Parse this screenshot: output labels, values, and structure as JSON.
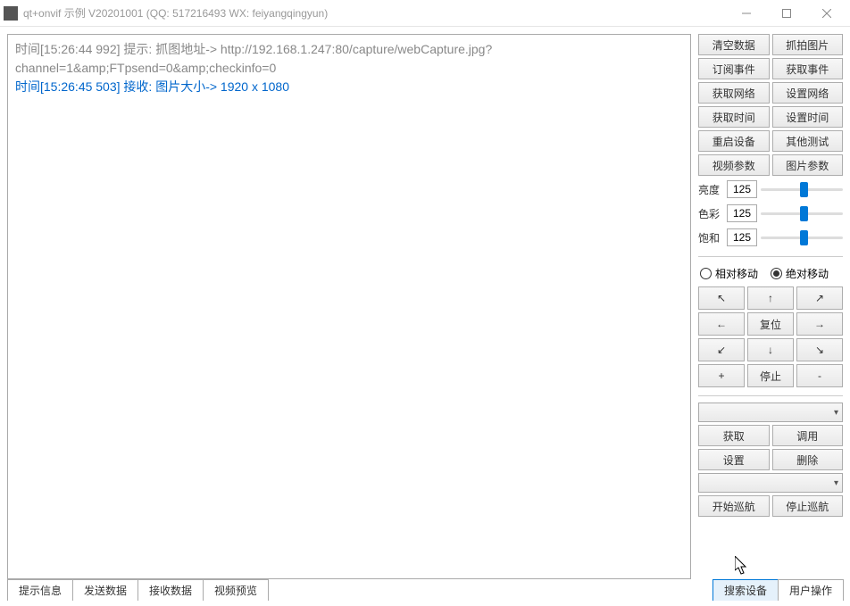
{
  "window": {
    "title": "qt+onvif 示例 V20201001 (QQ: 517216493 WX: feiyangqingyun)"
  },
  "log": {
    "line1": "时间[15:26:44 992] 提示: 抓图地址-> http://192.168.1.247:80/capture/webCapture.jpg?channel=1&amp;FTpsend=0&amp;checkinfo=0",
    "line2": "时间[15:26:45 503] 接收: 图片大小-> 1920 x 1080"
  },
  "buttons": {
    "clearData": "清空数据",
    "capture": "抓拍图片",
    "subEvent": "订阅事件",
    "getEvent": "获取事件",
    "getNet": "获取网络",
    "setNet": "设置网络",
    "getTime": "获取时间",
    "setTime": "设置时间",
    "reboot": "重启设备",
    "otherTest": "其他测试",
    "videoParam": "视频参数",
    "imageParam": "图片参数"
  },
  "sliders": {
    "brightness": {
      "label": "亮度",
      "value": "125"
    },
    "color": {
      "label": "色彩",
      "value": "125"
    },
    "saturation": {
      "label": "饱和",
      "value": "125"
    }
  },
  "move": {
    "relative": "相对移动",
    "absolute": "绝对移动",
    "reset": "复位",
    "stop": "停止",
    "plus": "+",
    "minus": "-"
  },
  "preset": {
    "get": "获取",
    "call": "调用",
    "set": "设置",
    "delete": "删除",
    "startCruise": "开始巡航",
    "stopCruise": "停止巡航"
  },
  "tabs": {
    "info": "提示信息",
    "send": "发送数据",
    "recv": "接收数据",
    "preview": "视频预览",
    "search": "搜索设备",
    "userOp": "用户操作"
  }
}
